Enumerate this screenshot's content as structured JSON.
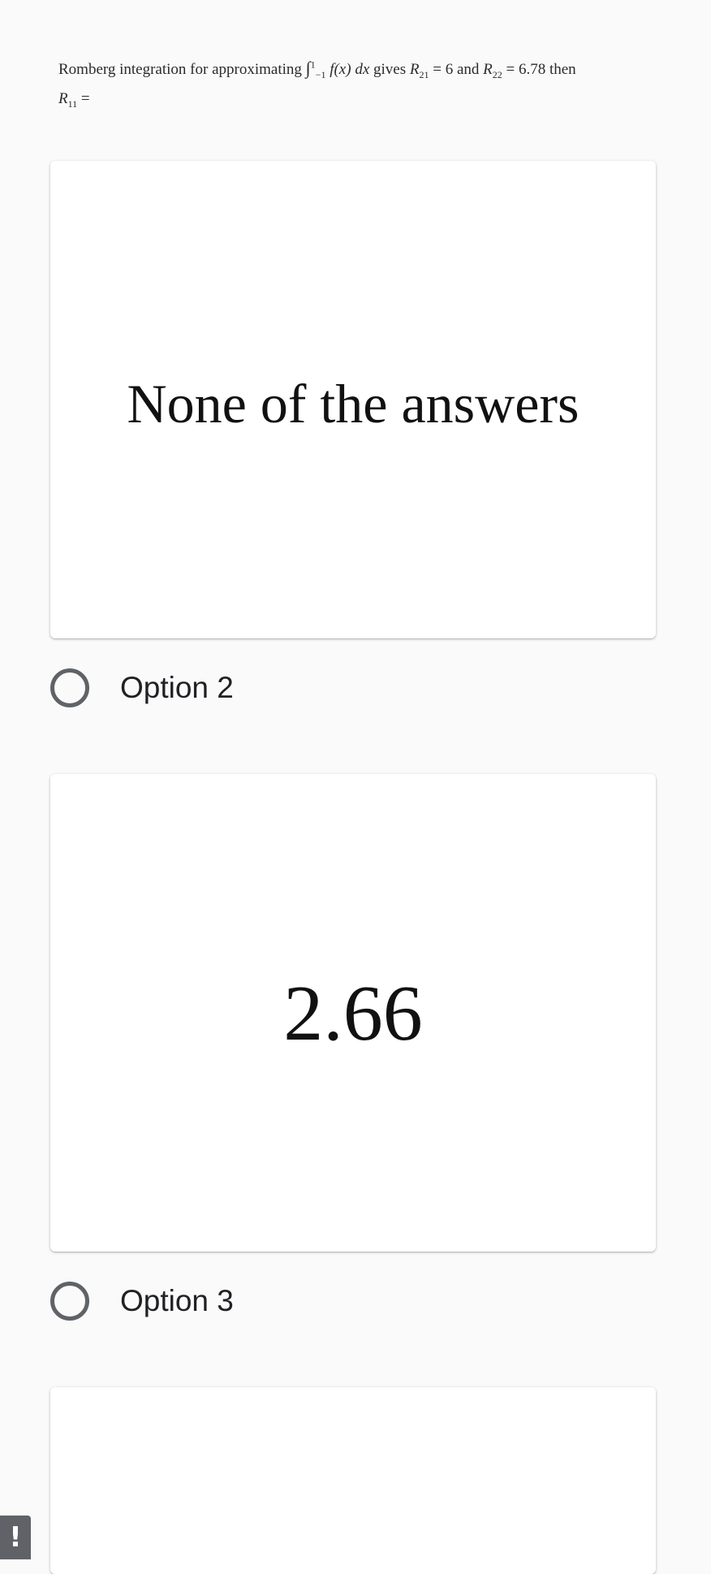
{
  "question": {
    "prefix": "Romberg integration for approximating ",
    "integral_sign": "∫",
    "lower": "−1",
    "upper": "1",
    "integrand": "f(x) dx",
    "gives": " gives ",
    "r21_symbol": "R",
    "r21_sub": "21",
    "r21_value": " = 6 and ",
    "r22_symbol": "R",
    "r22_sub": "22",
    "r22_value": " = 6.78 then",
    "r11_symbol": "R",
    "r11_sub": "11",
    "r11_value": " ="
  },
  "choices": [
    {
      "image_text": "None of the answers"
    },
    {
      "label": "Option 2",
      "image_text": "2.66"
    },
    {
      "label": "Option 3"
    }
  ],
  "alert_badge": {
    "icon": "exclamation-icon",
    "glyph": "!"
  },
  "colors": {
    "background": "#fafafa",
    "card": "#ffffff",
    "radio_border": "#5f6368",
    "text": "#202124"
  }
}
